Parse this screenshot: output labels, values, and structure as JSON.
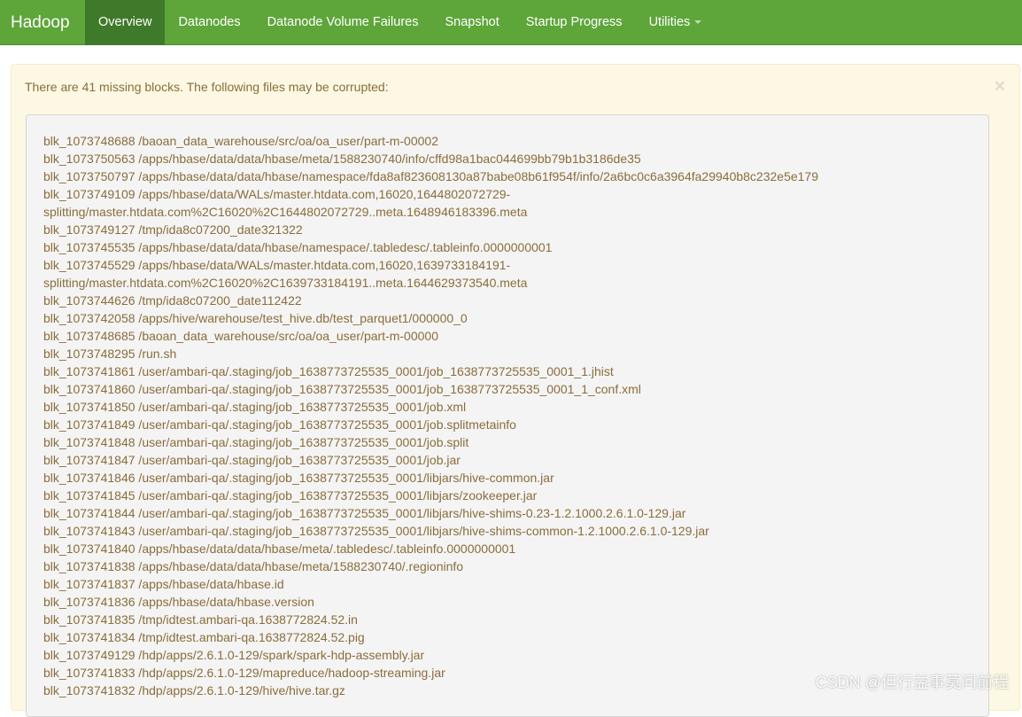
{
  "navbar": {
    "brand": "Hadoop",
    "items": [
      {
        "label": "Overview"
      },
      {
        "label": "Datanodes"
      },
      {
        "label": "Datanode Volume Failures"
      },
      {
        "label": "Snapshot"
      },
      {
        "label": "Startup Progress"
      },
      {
        "label": "Utilities"
      }
    ]
  },
  "alert": {
    "message": "There are 41 missing blocks. The following files may be corrupted:",
    "close": "×",
    "lines": [
      "blk_1073748688 /baoan_data_warehouse/src/oa/oa_user/part-m-00002",
      "blk_1073750563 /apps/hbase/data/data/hbase/meta/1588230740/info/cffd98a1bac044699bb79b1b3186de35",
      "blk_1073750797 /apps/hbase/data/data/hbase/namespace/fda8af823608130a87babe08b61f954f/info/2a6bc0c6a3964fa29940b8c232e5e179",
      "blk_1073749109 /apps/hbase/data/WALs/master.htdata.com,16020,1644802072729-",
      "splitting/master.htdata.com%2C16020%2C1644802072729..meta.1648946183396.meta",
      "blk_1073749127 /tmp/ida8c07200_date321322",
      "blk_1073745535 /apps/hbase/data/data/hbase/namespace/.tabledesc/.tableinfo.0000000001",
      "blk_1073745529 /apps/hbase/data/WALs/master.htdata.com,16020,1639733184191-",
      "splitting/master.htdata.com%2C16020%2C1639733184191..meta.1644629373540.meta",
      "blk_1073744626 /tmp/ida8c07200_date112422",
      "blk_1073742058 /apps/hive/warehouse/test_hive.db/test_parquet1/000000_0",
      "blk_1073748685 /baoan_data_warehouse/src/oa/oa_user/part-m-00000",
      "blk_1073748295 /run.sh",
      "blk_1073741861 /user/ambari-qa/.staging/job_1638773725535_0001/job_1638773725535_0001_1.jhist",
      "blk_1073741860 /user/ambari-qa/.staging/job_1638773725535_0001/job_1638773725535_0001_1_conf.xml",
      "blk_1073741850 /user/ambari-qa/.staging/job_1638773725535_0001/job.xml",
      "blk_1073741849 /user/ambari-qa/.staging/job_1638773725535_0001/job.splitmetainfo",
      "blk_1073741848 /user/ambari-qa/.staging/job_1638773725535_0001/job.split",
      "blk_1073741847 /user/ambari-qa/.staging/job_1638773725535_0001/job.jar",
      "blk_1073741846 /user/ambari-qa/.staging/job_1638773725535_0001/libjars/hive-common.jar",
      "blk_1073741845 /user/ambari-qa/.staging/job_1638773725535_0001/libjars/zookeeper.jar",
      "blk_1073741844 /user/ambari-qa/.staging/job_1638773725535_0001/libjars/hive-shims-0.23-1.2.1000.2.6.1.0-129.jar",
      "blk_1073741843 /user/ambari-qa/.staging/job_1638773725535_0001/libjars/hive-shims-common-1.2.1000.2.6.1.0-129.jar",
      "blk_1073741840 /apps/hbase/data/data/hbase/meta/.tabledesc/.tableinfo.0000000001",
      "blk_1073741838 /apps/hbase/data/data/hbase/meta/1588230740/.regioninfo",
      "blk_1073741837 /apps/hbase/data/hbase.id",
      "blk_1073741836 /apps/hbase/data/hbase.version",
      "blk_1073741835 /tmp/idtest.ambari-qa.1638772824.52.in",
      "blk_1073741834 /tmp/idtest.ambari-qa.1638772824.52.pig",
      "blk_1073749129 /hdp/apps/2.6.1.0-129/spark/spark-hdp-assembly.jar",
      "blk_1073741833 /hdp/apps/2.6.1.0-129/mapreduce/hadoop-streaming.jar",
      "blk_1073741832 /hdp/apps/2.6.1.0-129/hive/hive.tar.gz"
    ]
  },
  "watermark": "CSDN @但行益事莫问前程",
  "colors": {
    "navbar_bg": "#5ea53a",
    "navbar_active": "#3f7a2a",
    "alert_bg": "#fcf8e3",
    "alert_text": "#8a6d3b",
    "box_bg": "#f4f4f4"
  }
}
